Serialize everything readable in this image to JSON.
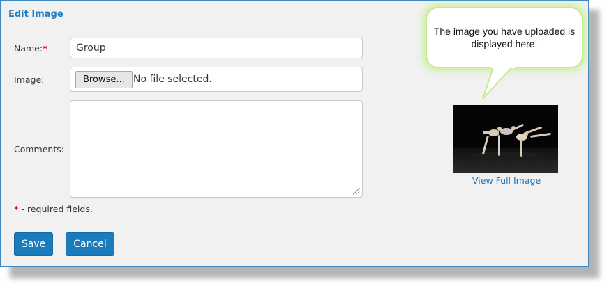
{
  "form": {
    "title": "Edit Image",
    "name_label": "Name:",
    "required_marker": "*",
    "name_value": "Group",
    "image_label": "Image:",
    "browse_label": "Browse...",
    "file_status": "No file selected.",
    "comments_label": "Comments:",
    "comments_value": "",
    "required_note_star": "*",
    "required_note_text": " - required fields.",
    "save_label": "Save",
    "cancel_label": "Cancel"
  },
  "preview": {
    "callout_text": "The image you have uploaded is displayed here.",
    "view_full_label": "View Full Image",
    "image_subject": "dancers-photo"
  },
  "colors": {
    "accent": "#1a7bbd",
    "title": "#1f7fc0",
    "required": "#e00000",
    "callout_glow": "#c3ec8a",
    "panel_bg": "#f1f1f1"
  }
}
